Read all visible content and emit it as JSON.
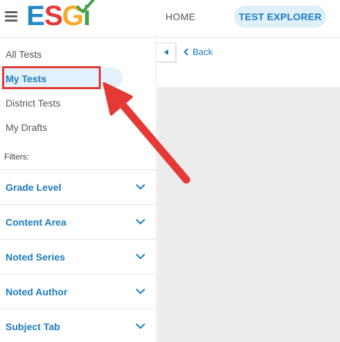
{
  "header": {
    "logo": {
      "e": "E",
      "s": "S",
      "g": "G",
      "i": "i"
    },
    "nav": {
      "home": "HOME",
      "test_explorer": "TEST EXPLORER"
    }
  },
  "sidebar": {
    "items": [
      {
        "label": "All Tests",
        "active": false
      },
      {
        "label": "My Tests",
        "active": true
      },
      {
        "label": "District Tests",
        "active": false
      },
      {
        "label": "My Drafts",
        "active": false
      }
    ],
    "filters_label": "Filters:",
    "filters": [
      {
        "label": "Grade Level",
        "icon": "chevron-down-icon"
      },
      {
        "label": "Content Area",
        "icon": "chevron-down-icon"
      },
      {
        "label": "Noted Series",
        "icon": "chevron-down-icon"
      },
      {
        "label": "Noted Author",
        "icon": "chevron-down-icon"
      },
      {
        "label": "Subject Tab",
        "icon": "chevron-down-icon"
      }
    ]
  },
  "main": {
    "back_label": "Back"
  },
  "annotation": {
    "highlight_color": "#e53935"
  },
  "colors": {
    "accent": "#1c7bbd",
    "pill_bg": "#dff0fb",
    "content_bg": "#ececec"
  }
}
